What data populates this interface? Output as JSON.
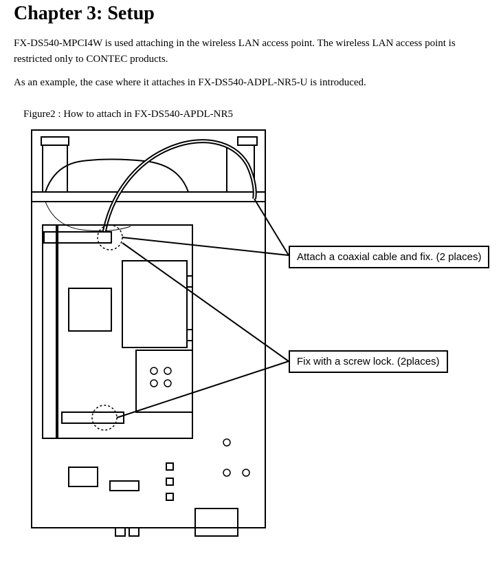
{
  "chapter": {
    "title": "Chapter 3: Setup",
    "para1": "FX-DS540-MPCI4W is used attaching in the wireless LAN access point. The wireless LAN access point is restricted only to CONTEC products.",
    "para2": "As an example, the case where it attaches in FX-DS540-ADPL-NR5-U is introduced."
  },
  "figure": {
    "caption": "Figure2 : How to attach in FX-DS540-APDL-NR5",
    "callouts": {
      "coax": "Attach a coaxial cable and fix. (2 places)",
      "screw": "Fix with a screw lock. (2places)"
    }
  }
}
